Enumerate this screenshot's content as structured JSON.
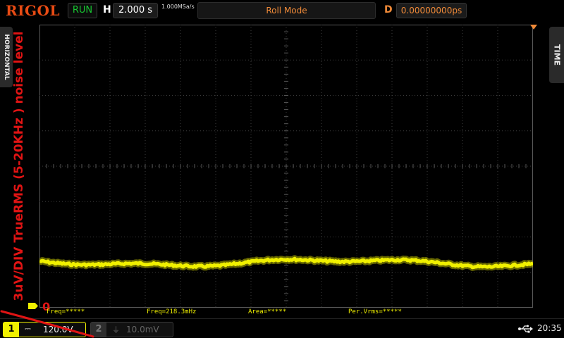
{
  "top_bar": {
    "brand": "RIGOL",
    "run_status": "RUN",
    "h_label": "H",
    "timebase": "2.000 s",
    "sample_rate": "1.000MSa/s",
    "mode": "Roll Mode",
    "d_label": "D",
    "delay": "0.00000000ps"
  },
  "side_tabs": {
    "left": "HORIZONTAL",
    "right": "TIME"
  },
  "annotation": {
    "text": "3uV/DIV TrueRMS (5-20KHz ) noise level",
    "zero_label": "0"
  },
  "measurements": [
    {
      "label": "Freq=*****"
    },
    {
      "label": "Freq=218.3mHz"
    },
    {
      "label": "Area=*****"
    },
    {
      "label": "Per.Vrms=*****"
    }
  ],
  "channels": {
    "ch1": {
      "number": "1",
      "coupling": "⎓",
      "scale": "120.0V"
    },
    "ch2": {
      "number": "2",
      "coupling": "⏚",
      "scale": "10.0mV"
    }
  },
  "status": {
    "time": "20:35"
  },
  "colors": {
    "ch1": "#f0f000",
    "brand": "#e84b14",
    "accent": "#f08a38",
    "run": "#18c832",
    "annotation": "#e01414"
  },
  "icons": [
    "usb-icon",
    "trigger-marker-icon",
    "channel1-ground-marker-icon"
  ]
}
